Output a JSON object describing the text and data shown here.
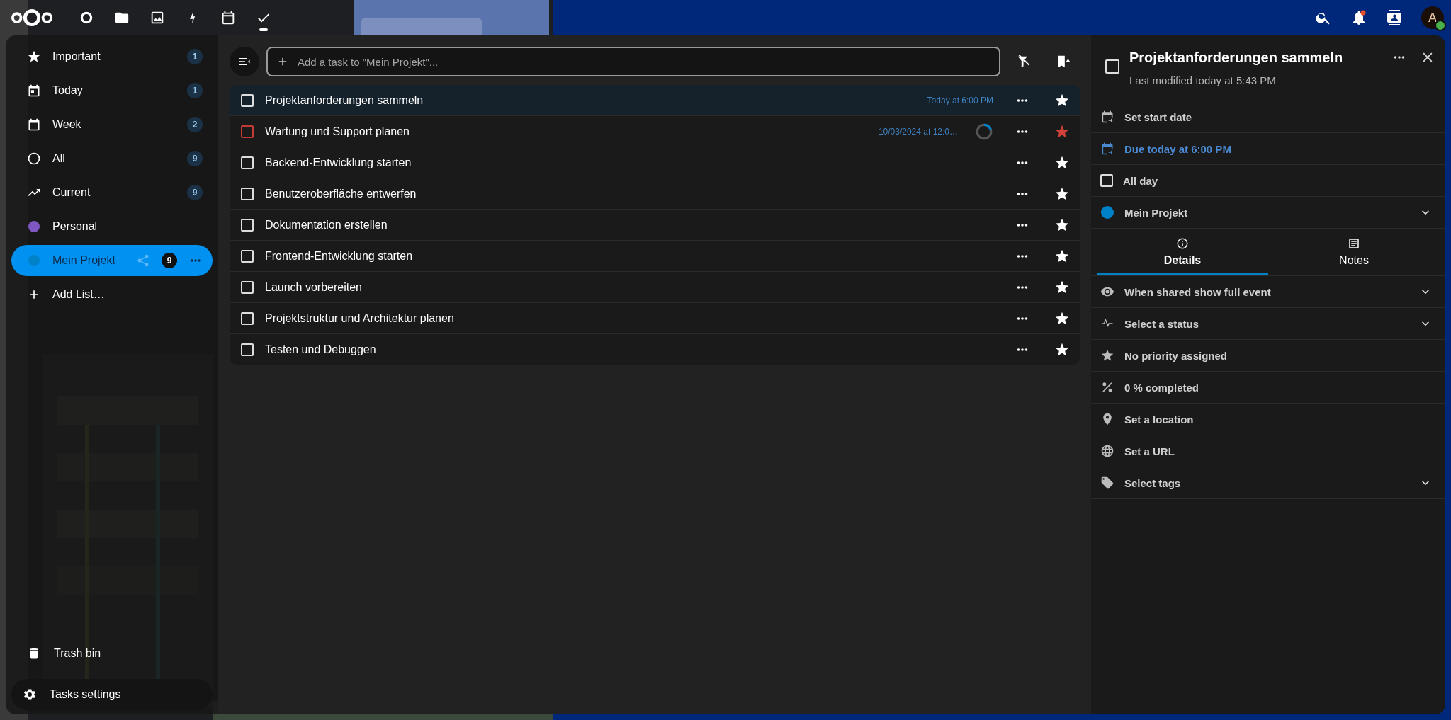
{
  "header": {
    "apps": [
      {
        "kind": "dashboard",
        "selected": false
      },
      {
        "kind": "files",
        "selected": false
      },
      {
        "kind": "photos",
        "selected": false
      },
      {
        "kind": "activity",
        "selected": false
      },
      {
        "kind": "calendar",
        "selected": false
      },
      {
        "kind": "tasks",
        "selected": true
      }
    ],
    "notifications_unread": true,
    "avatar": "A",
    "online": true
  },
  "sidebar": {
    "items": [
      {
        "kind": "important",
        "label": "Important",
        "count": "1",
        "selected": false
      },
      {
        "kind": "today",
        "label": "Today",
        "count": "1",
        "selected": false
      },
      {
        "kind": "week",
        "label": "Week",
        "count": "2",
        "selected": false
      },
      {
        "kind": "all",
        "label": "All",
        "count": "9",
        "selected": false
      },
      {
        "kind": "current",
        "label": "Current",
        "count": "9",
        "selected": false
      },
      {
        "kind": "list",
        "label": "Personal",
        "color": "#7e57c2",
        "shared": false,
        "selected": false
      },
      {
        "kind": "list",
        "label": "Mein Projekt",
        "color": "#0082c9",
        "count": "9",
        "shared": true,
        "selected": true
      },
      {
        "kind": "add",
        "label": "Add List…",
        "selected": false
      }
    ],
    "footer": [
      {
        "kind": "trash",
        "label": "Trash bin"
      },
      {
        "kind": "settings",
        "label": "Tasks settings"
      }
    ]
  },
  "toolbar": {
    "placeholder": "Add a task to \"Mein Projekt\"..."
  },
  "tasks": [
    {
      "title": "Projektanforderungen sammeln",
      "due": "Today at 6:00 PM",
      "checked": false,
      "high_priority": false,
      "selected": true
    },
    {
      "title": "Wartung und Support planen",
      "due": "10/03/2024 at 12:0…",
      "level": 0.2,
      "checked": false,
      "high_priority": true,
      "selected": false
    },
    {
      "title": "Backend-Entwicklung starten",
      "checked": false,
      "high_priority": false,
      "selected": false
    },
    {
      "title": "Benutzeroberfläche entwerfen",
      "checked": false,
      "high_priority": false,
      "selected": false
    },
    {
      "title": "Dokumentation erstellen",
      "checked": false,
      "high_priority": false,
      "selected": false
    },
    {
      "title": "Frontend-Entwicklung starten",
      "checked": false,
      "high_priority": false,
      "selected": false
    },
    {
      "title": "Launch vorbereiten",
      "checked": false,
      "high_priority": false,
      "selected": false
    },
    {
      "title": "Projektstruktur und Architektur planen",
      "checked": false,
      "high_priority": false,
      "selected": false
    },
    {
      "title": "Testen und Debuggen",
      "checked": false,
      "high_priority": false,
      "selected": false
    }
  ],
  "details": {
    "title": "Projektanforderungen sammeln",
    "checked": false,
    "modified": "Last modified today at 5:43 PM",
    "top_rows": [
      {
        "kind": "start",
        "text": "Set start date",
        "highlight": false,
        "dropdown": false
      },
      {
        "kind": "due",
        "text": "Due today at 6:00 PM",
        "highlight": true,
        "dropdown": false
      },
      {
        "kind": "checkbox",
        "text": "All day",
        "checked": false,
        "highlight": false,
        "dropdown": false
      },
      {
        "kind": "list",
        "text": "Mein Projekt",
        "color": "#0082c9",
        "highlight": false,
        "dropdown": true
      }
    ],
    "tabs": [
      {
        "kind": "info",
        "label": "Details",
        "selected": true
      },
      {
        "kind": "notes",
        "label": "Notes",
        "selected": false
      }
    ],
    "rows": [
      {
        "kind": "eye",
        "text": "When shared show full event",
        "dropdown": true
      },
      {
        "kind": "pulse",
        "text": "Select a status",
        "dropdown": true
      },
      {
        "kind": "star",
        "text": "No priority assigned",
        "dropdown": false
      },
      {
        "kind": "percent",
        "text": "0 % completed",
        "dropdown": false
      },
      {
        "kind": "pin",
        "text": "Set a location",
        "dropdown": false
      },
      {
        "kind": "globe",
        "text": "Set a URL",
        "dropdown": false
      },
      {
        "kind": "tag",
        "text": "Select tags",
        "dropdown": true
      }
    ]
  }
}
